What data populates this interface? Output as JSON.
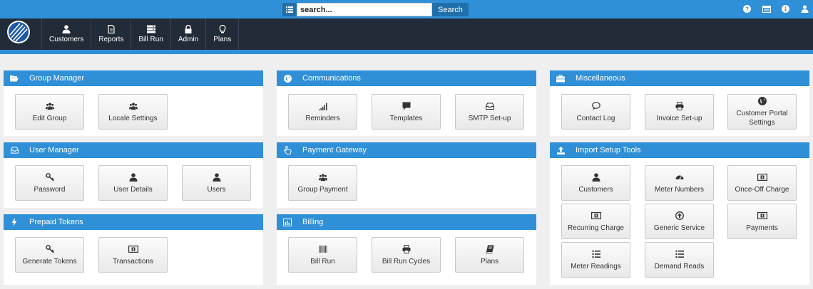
{
  "search": {
    "value": "search...",
    "button": "Search"
  },
  "nav": [
    "Customers",
    "Reports",
    "Bill Run",
    "Admin",
    "Plans"
  ],
  "panels": {
    "group_manager": {
      "title": "Group Manager",
      "tiles": [
        "Edit Group",
        "Locale Settings"
      ]
    },
    "communications": {
      "title": "Communications",
      "tiles": [
        "Reminders",
        "Templates",
        "SMTP Set-up"
      ]
    },
    "miscellaneous": {
      "title": "Miscellaneous",
      "tiles": [
        "Contact Log",
        "Invoice Set-up",
        "Customer Portal Settings"
      ]
    },
    "user_manager": {
      "title": "User Manager",
      "tiles": [
        "Password",
        "User Details",
        "Users"
      ]
    },
    "payment_gateway": {
      "title": "Payment Gateway",
      "tiles": [
        "Group Payment"
      ]
    },
    "import_setup": {
      "title": "Import Setup Tools",
      "tiles": [
        "Customers",
        "Meter Numbers",
        "Once-Off Charge",
        "Recurring Charge",
        "Generic Service",
        "Payments",
        "Meter Readings",
        "Demand Reads"
      ]
    },
    "prepaid_tokens": {
      "title": "Prepaid Tokens",
      "tiles": [
        "Generate Tokens",
        "Transactions"
      ]
    },
    "billing": {
      "title": "Billing",
      "tiles": [
        "Bill Run",
        "Bill Run Cycles",
        "Plans"
      ]
    }
  }
}
